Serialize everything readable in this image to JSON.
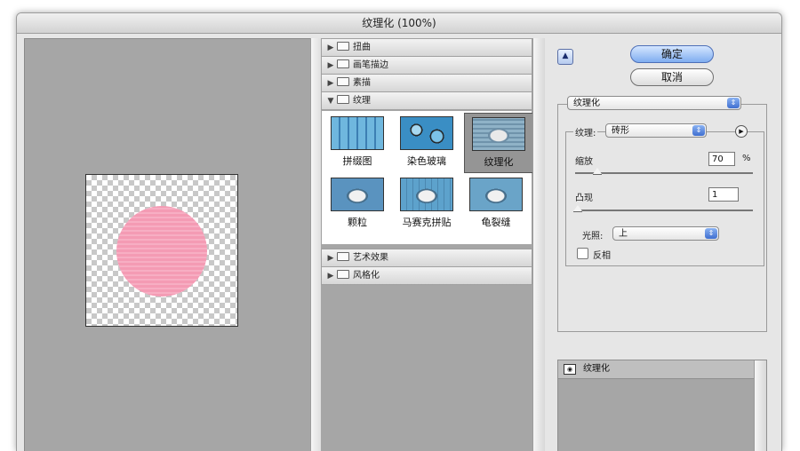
{
  "window": {
    "title": "纹理化 (100%)"
  },
  "filter_categories": [
    {
      "label": "扭曲",
      "expanded": false
    },
    {
      "label": "画笔描边",
      "expanded": false
    },
    {
      "label": "素描",
      "expanded": false
    },
    {
      "label": "纹理",
      "expanded": true
    },
    {
      "label": "艺术效果",
      "expanded": false
    },
    {
      "label": "风格化",
      "expanded": false
    }
  ],
  "texture_filters": [
    "拼缀图",
    "染色玻璃",
    "纹理化",
    "颗粒",
    "马赛克拼贴",
    "龟裂缝"
  ],
  "selected_filter": "纹理化",
  "buttons": {
    "ok": "确定",
    "cancel": "取消"
  },
  "settings": {
    "filter_select": "纹理化",
    "texture_label": "纹理:",
    "texture_value": "砖形",
    "scaling_label": "缩放",
    "scaling_value": "70",
    "scaling_unit": "%",
    "relief_label": "凸现",
    "relief_value": "1",
    "light_label": "光照:",
    "light_value": "上",
    "invert_label": "反相",
    "invert_checked": false
  },
  "layers": [
    {
      "label": "纹理化",
      "visible": true
    }
  ],
  "colors": {
    "preview_fill": "#f49bb4",
    "accent": "#6f9de8"
  }
}
